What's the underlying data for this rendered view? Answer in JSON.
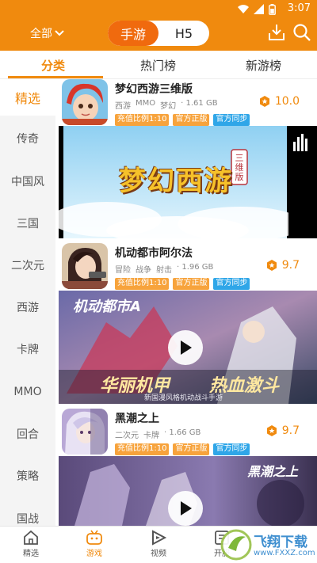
{
  "status_bar": {
    "time": "3:07"
  },
  "header": {
    "scope_label": "全部",
    "segment": {
      "active": "手游",
      "inactive": "H5"
    },
    "icons": [
      "download-icon",
      "search-icon"
    ]
  },
  "tabs": [
    {
      "label": "分类",
      "active": true
    },
    {
      "label": "热门榜",
      "active": false
    },
    {
      "label": "新游榜",
      "active": false
    }
  ],
  "categories": [
    "精选",
    "传奇",
    "中国风",
    "三国",
    "二次元",
    "西游",
    "卡牌",
    "MMO",
    "回合",
    "策略",
    "国战"
  ],
  "active_category": "精选",
  "games": [
    {
      "title": "梦幻西游三维版",
      "genres": [
        "西游",
        "MMO",
        "梦幻"
      ],
      "size": "· 1.61 GB",
      "tags": [
        "充值比例1:10",
        "官方正版",
        "官方同步"
      ],
      "score": "10.0",
      "banner_logo": "梦幻西游",
      "banner_badge": "三维版"
    },
    {
      "title": "机动都市阿尔法",
      "genres": [
        "冒险",
        "战争",
        "射击"
      ],
      "size": "· 1.96 GB",
      "tags": [
        "充值比例1:10",
        "官方正版",
        "官方同步"
      ],
      "score": "9.7",
      "banner_logo": "机动都市A",
      "banner_slogan_left": "华丽机甲",
      "banner_slogan_right": "热血激斗",
      "banner_subline": "新国漫风格机动战斗手游"
    },
    {
      "title": "黑潮之上",
      "genres": [
        "二次元",
        "卡牌"
      ],
      "size": "· 1.66 GB",
      "tags": [
        "充值比例1:10",
        "官方正版",
        "官方同步"
      ],
      "score": "9.7",
      "banner_logo": "黑潮之上"
    }
  ],
  "bottom_nav": [
    {
      "label": "精选",
      "icon": "home-icon",
      "active": false
    },
    {
      "label": "游戏",
      "icon": "gamepad-icon",
      "active": true
    },
    {
      "label": "视频",
      "icon": "video-play-icon",
      "active": false
    },
    {
      "label": "开服",
      "icon": "server-open-icon",
      "active": false
    }
  ],
  "watermark": {
    "text": "飞翔下载",
    "site": "www.FXXZ.com"
  },
  "colors": {
    "brand_orange": "#f08a0e",
    "tag_orange": "#f7a33c",
    "tag_blue": "#2fa6e8",
    "sidebar_bg": "#f4f4f4"
  }
}
